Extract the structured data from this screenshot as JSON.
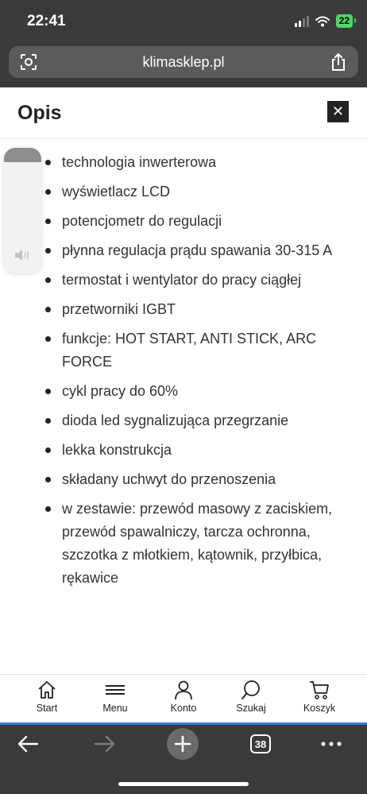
{
  "status_bar": {
    "time": "22:41",
    "battery": "22"
  },
  "browser": {
    "url": "klimasklep.pl",
    "tab_count": "38"
  },
  "page": {
    "title": "Opis",
    "close_label": "✕",
    "features": [
      "technologia inwerterowa",
      "wyświetlacz LCD",
      "potencjometr do regulacji",
      "płynna regulacja prądu spawania 30-315 A",
      "termostat i wentylator do pracy ciągłej",
      "przetworniki IGBT",
      "funkcje: HOT START, ANTI STICK, ARC FORCE",
      "cykl pracy do 60%",
      "dioda led sygnalizująca przegrzanie",
      "lekka konstrukcja",
      "składany uchwyt do przenoszenia",
      "w zestawie: przewód masowy z zaciskiem, przewód spawalniczy, tarcza ochronna, szczotka z młotkiem, kątownik, przyłbica, rękawice"
    ]
  },
  "shop_nav": {
    "items": [
      {
        "label": "Start",
        "icon": "home-icon"
      },
      {
        "label": "Menu",
        "icon": "menu-icon"
      },
      {
        "label": "Konto",
        "icon": "user-icon"
      },
      {
        "label": "Szukaj",
        "icon": "search-icon"
      },
      {
        "label": "Koszyk",
        "icon": "cart-icon"
      }
    ]
  },
  "colors": {
    "chrome": "#3a3a3c",
    "accent_line": "#2f7fd6",
    "battery": "#4cd964"
  }
}
